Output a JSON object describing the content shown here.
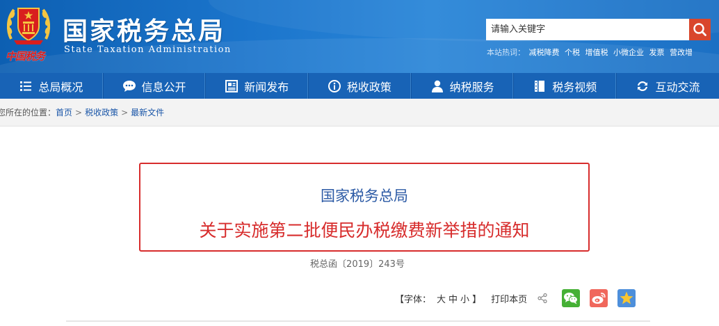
{
  "header": {
    "emblem_caption": "中国税务",
    "title": "国家税务总局",
    "subtitle": "State Taxation Administration",
    "search": {
      "placeholder": "请输入关键字"
    },
    "hot_label": "本站热词：",
    "hot_words": [
      "减税降费",
      "个税",
      "增值税",
      "小微企业",
      "发票",
      "营改增"
    ]
  },
  "nav": {
    "items": [
      {
        "label": "总局概况",
        "icon": "list-icon"
      },
      {
        "label": "信息公开",
        "icon": "chat-bubble-icon"
      },
      {
        "label": "新闻发布",
        "icon": "newspaper-icon"
      },
      {
        "label": "税收政策",
        "icon": "info-icon"
      },
      {
        "label": "纳税服务",
        "icon": "person-icon"
      },
      {
        "label": "税务视频",
        "icon": "film-icon"
      },
      {
        "label": "互动交流",
        "icon": "refresh-icon"
      }
    ]
  },
  "breadcrumb": {
    "prefix": "您所在的位置：",
    "items": [
      "首页",
      "税收政策",
      "最新文件"
    ],
    "separator": ">"
  },
  "article": {
    "org": "国家税务总局",
    "title": "关于实施第二批便民办税缴费新举措的通知",
    "doc_number": "税总函〔2019〕243号"
  },
  "tools": {
    "font_label": "【字体：",
    "font_large": "大",
    "font_medium": "中",
    "font_small": "小",
    "font_close": "】",
    "print": "打印本页"
  },
  "colors": {
    "header_blue": "#1b75cc",
    "nav_blue": "#1863b6",
    "accent_red": "#d72c2c",
    "title_blue": "#2c5aa5"
  }
}
